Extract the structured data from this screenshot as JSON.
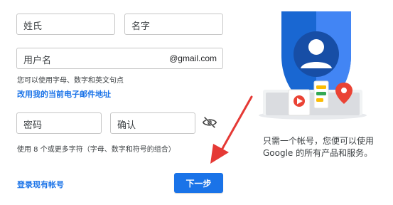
{
  "form": {
    "last_name_placeholder": "姓氏",
    "first_name_placeholder": "名字",
    "username_placeholder": "用户名",
    "username_suffix": "@gmail.com",
    "username_hint": "您可以使用字母、数字和英文句点",
    "use_current_email_link": "改用我的当前电子邮件地址",
    "password_placeholder": "密码",
    "confirm_placeholder": "确认",
    "password_hint": "使用 8 个或更多字符（字母、数字和符号的组合）",
    "sign_in_link": "登录现有帐号",
    "next_button": "下一步"
  },
  "sidebar": {
    "caption_line1": "只需一个帐号，您便可以使用",
    "caption_line2": "Google 的所有产品和服务。"
  },
  "colors": {
    "accent": "#1a73e8",
    "shield": "#4285f4",
    "arrow": "#e53935",
    "red": "#ea4335",
    "yellow": "#fbbc04",
    "green": "#34a853"
  },
  "icons": {
    "password_visibility": "eye-off-icon",
    "illustration": "account-shield-illustration"
  }
}
